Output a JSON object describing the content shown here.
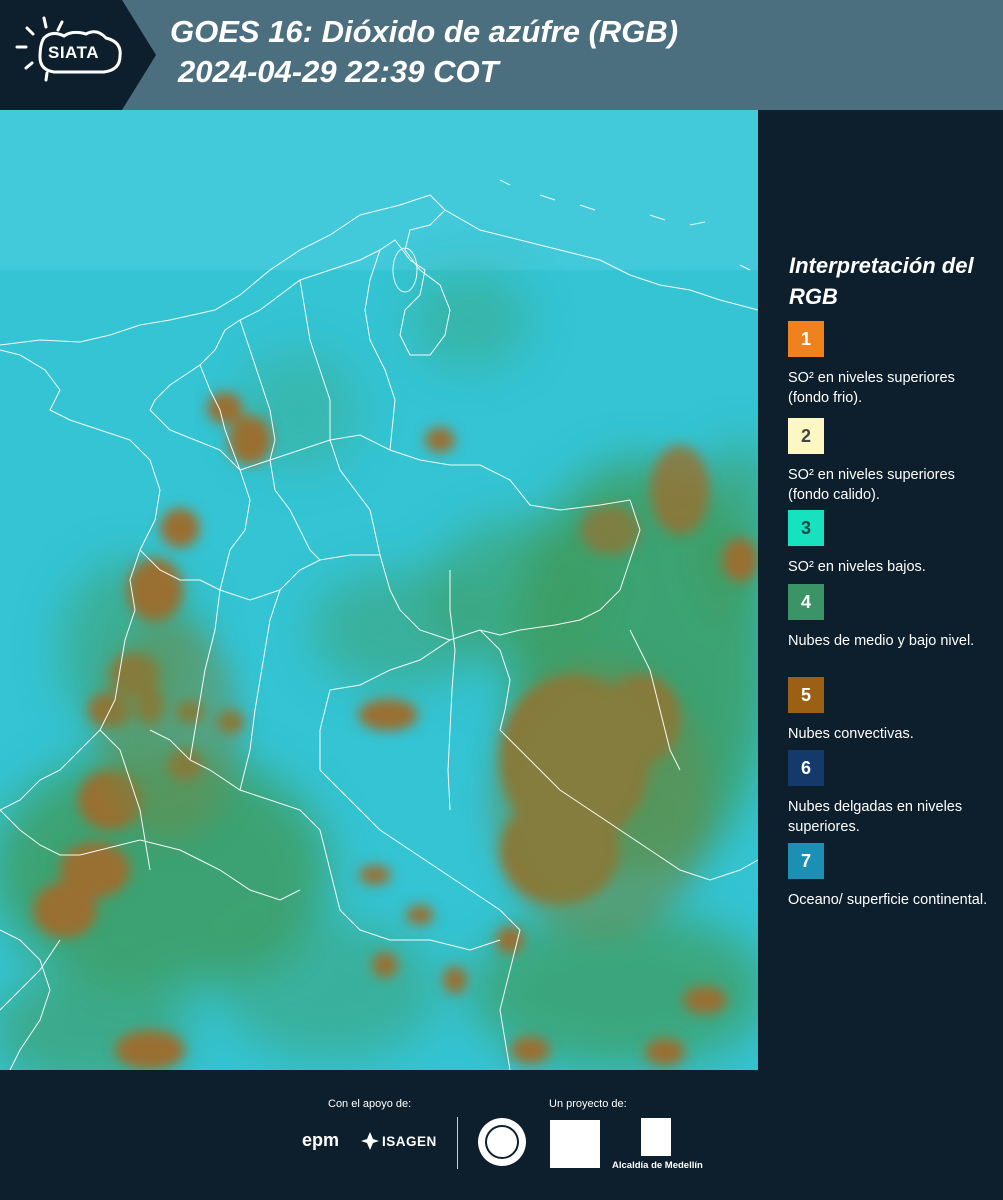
{
  "header": {
    "logo_text": "SIATA",
    "title_line1": "GOES 16: Dióxido de azúfre (RGB)",
    "title_line2": "2024-04-29 22:39 COT"
  },
  "map": {
    "background_color": "#34c4d4",
    "cloud_color": "#9a7030",
    "vegetation_color": "#3f9a5a",
    "border_color": "#ffffff"
  },
  "legend": {
    "title": "Interpretación del RGB",
    "items": [
      {
        "number": "1",
        "color": "#f0821e",
        "text_color": "#ffffff",
        "label": "SO² en niveles superiores (fondo frio)."
      },
      {
        "number": "2",
        "color": "#fdf7c4",
        "text_color": "#444444",
        "label": "SO² en niveles superiores (fondo calido)."
      },
      {
        "number": "3",
        "color": "#16e2c0",
        "text_color": "#1d4a45",
        "label": "SO² en niveles bajos."
      },
      {
        "number": "4",
        "color": "#3a9466",
        "text_color": "#ffffff",
        "label": "Nubes de medio y bajo nivel."
      },
      {
        "number": "5",
        "color": "#9c6014",
        "text_color": "#ffffff",
        "label": "Nubes convectivas."
      },
      {
        "number": "6",
        "color": "#143a6b",
        "text_color": "#ffffff",
        "label": "Nubes delgadas en niveles superiores."
      },
      {
        "number": "7",
        "color": "#1c8fb5",
        "text_color": "#ffffff",
        "label": "Oceano/ superficie continental."
      }
    ]
  },
  "footer": {
    "support_label": "Con el apoyo de:",
    "project_label": "Un proyecto de:",
    "epm_text": "epm",
    "isagen_text": "ISAGEN",
    "alcaldia_text": "Alcaldía de Medellín"
  }
}
